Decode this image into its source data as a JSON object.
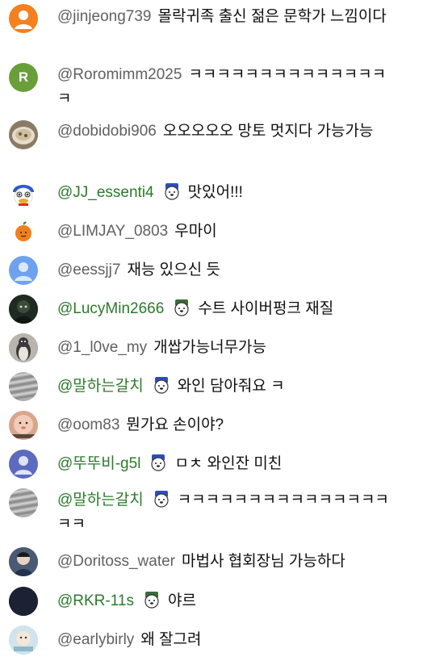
{
  "messages": [
    {
      "author": "@jinjeong739",
      "text": "몰락귀족 출신 젊은 문학가 느낌이다",
      "avatar": {
        "type": "person-icon",
        "bg": "#f4801f"
      },
      "member": false,
      "badge": null
    },
    {
      "author": "@Roromimm2025",
      "text": "ㅋㅋㅋㅋㅋㅋㅋㅋㅋㅋㅋㅋㅋㅋㅋ",
      "avatar": {
        "type": "letter",
        "letter": "R",
        "bg": "#689f38"
      },
      "member": false,
      "badge": null
    },
    {
      "author": "@dobidobi906",
      "text": "오오오오오 망토 멋지다 가능가능",
      "avatar": {
        "type": "photo",
        "bg": "#b7a68a"
      },
      "member": false,
      "badge": null
    },
    {
      "author": "@JJ_essenti4",
      "text": "맛있어!!!",
      "avatar": {
        "type": "photo",
        "bg": "#3a63c4"
      },
      "member": true,
      "badge": "member-badge-blue"
    },
    {
      "author": "@LIMJAY_0803",
      "text": "우마이",
      "avatar": {
        "type": "photo",
        "bg": "#f07f1b"
      },
      "member": false,
      "badge": null
    },
    {
      "author": "@eessjj7",
      "text": "재능 있으신 듯",
      "avatar": {
        "type": "person-icon",
        "bg": "#6fa2ee"
      },
      "member": false,
      "badge": null
    },
    {
      "author": "@LucyMin2666",
      "text": "수트 사이버펑크 재질",
      "avatar": {
        "type": "photo",
        "bg": "#2c2c2c"
      },
      "member": true,
      "badge": "member-badge-green"
    },
    {
      "author": "@1_l0ve_my",
      "text": "개쌉가능너무가능",
      "avatar": {
        "type": "photo",
        "bg": "#8c8c8c"
      },
      "member": false,
      "badge": null
    },
    {
      "author": "@말하는갈치",
      "text": "와인 담아줘요 ㅋ",
      "avatar": {
        "type": "photo",
        "bg": "#a8a8a8"
      },
      "member": true,
      "badge": "member-badge-blue"
    },
    {
      "author": "@oom83",
      "text": "뭔가요 손이야?",
      "avatar": {
        "type": "photo",
        "bg": "#e8b9a4"
      },
      "member": false,
      "badge": null
    },
    {
      "author": "@뚜뚜비-g5l",
      "text": "ㅁㅊ 와인잔 미친",
      "avatar": {
        "type": "person-icon",
        "bg": "#5c6bc0"
      },
      "member": true,
      "badge": "member-badge-blue"
    },
    {
      "author": "@말하는갈치",
      "text": "ㅋㅋㅋㅋㅋㅋㅋㅋㅋㅋㅋㅋㅋㅋㅋㅋㅋ",
      "avatar": {
        "type": "photo",
        "bg": "#a8a8a8"
      },
      "member": true,
      "badge": "member-badge-blue"
    },
    {
      "author": "@Doritoss_water",
      "text": "마법사 협회장님 가능하다",
      "avatar": {
        "type": "photo",
        "bg": "#3a4a60"
      },
      "member": false,
      "badge": null
    },
    {
      "author": "@RKR-11s",
      "text": "야르",
      "avatar": {
        "type": "photo",
        "bg": "#1c2233"
      },
      "member": true,
      "badge": "member-badge-green"
    },
    {
      "author": "@earlybirly",
      "text": "왜 잘그려",
      "avatar": {
        "type": "photo",
        "bg": "#9fc8d8"
      },
      "member": false,
      "badge": null
    }
  ]
}
